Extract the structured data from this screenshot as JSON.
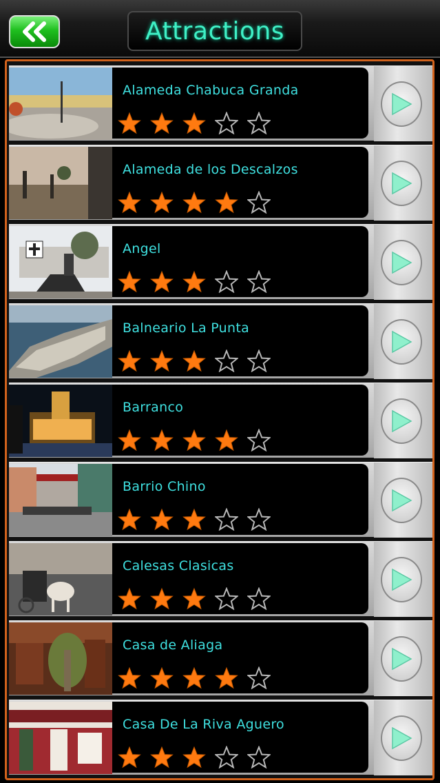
{
  "header": {
    "title": "Attractions",
    "back_icon": "double-chevron-left-icon",
    "back_color": "#1fbf1f",
    "title_color": "#3ff0c6"
  },
  "list": {
    "frame_color": "#d2621c",
    "star_filled_color": "#ff7a10",
    "name_color": "#3fe0e0",
    "items": [
      {
        "name": "Alameda Chabuca Granda",
        "rating": 3,
        "max_rating": 5,
        "thumb": "plaza"
      },
      {
        "name": "Alameda de los Descalzos",
        "rating": 4,
        "max_rating": 5,
        "thumb": "avenue"
      },
      {
        "name": "Angel",
        "rating": 3,
        "max_rating": 5,
        "thumb": "cemetery"
      },
      {
        "name": "Balneario La Punta",
        "rating": 3,
        "max_rating": 5,
        "thumb": "coast"
      },
      {
        "name": "Barranco",
        "rating": 4,
        "max_rating": 5,
        "thumb": "night"
      },
      {
        "name": "Barrio Chino",
        "rating": 3,
        "max_rating": 5,
        "thumb": "street"
      },
      {
        "name": "Calesas Clasicas",
        "rating": 3,
        "max_rating": 5,
        "thumb": "carriage"
      },
      {
        "name": "Casa de Aliaga",
        "rating": 4,
        "max_rating": 5,
        "thumb": "courtyard"
      },
      {
        "name": "Casa De La Riva Aguero",
        "rating": 3,
        "max_rating": 5,
        "thumb": "balcony"
      }
    ]
  }
}
